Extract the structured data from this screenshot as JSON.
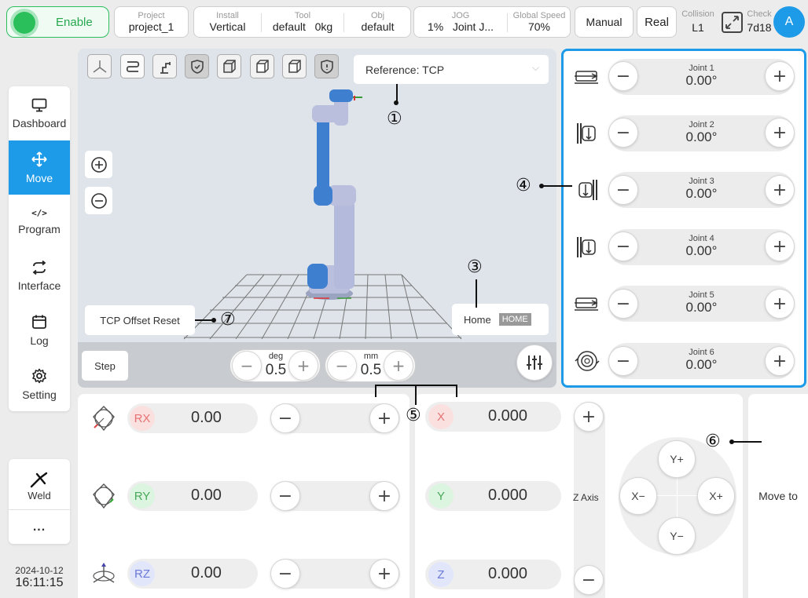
{
  "header": {
    "enable_label": "Enable",
    "project": {
      "label": "Project",
      "value": "project_1"
    },
    "install": {
      "label": "Install",
      "value": "Vertical"
    },
    "tool": {
      "label": "Tool",
      "value": "default",
      "load": "0kg"
    },
    "obj": {
      "label": "Obj",
      "value": "default"
    },
    "jog": {
      "label": "JOG",
      "percent": "1%",
      "mode": "Joint J..."
    },
    "global_speed": {
      "label": "Global Speed",
      "value": "70%"
    },
    "mode_button": "Manual",
    "real_button": "Real",
    "collision": {
      "label": "Collision",
      "value": "L1"
    },
    "check": {
      "label": "Check",
      "value": "7d18"
    },
    "avatar": "A"
  },
  "sidebar": {
    "items": [
      {
        "label": "Dashboard",
        "icon": "monitor-icon"
      },
      {
        "label": "Move",
        "icon": "move-arrows-icon",
        "active": true
      },
      {
        "label": "Program",
        "icon": "code-icon"
      },
      {
        "label": "Interface",
        "icon": "swap-icon"
      },
      {
        "label": "Log",
        "icon": "calendar-icon"
      },
      {
        "label": "Setting",
        "icon": "gear-icon"
      }
    ],
    "weld_label": "Weld",
    "more_label": "...",
    "date": "2024-10-12",
    "time": "16:11:15"
  },
  "viewport": {
    "reference": "Reference: TCP",
    "tcp_offset_reset": "TCP Offset Reset",
    "home_label": "Home",
    "home_badge": "HOME",
    "step_label": "Step",
    "deg_unit": "deg",
    "deg_value": "0.5",
    "mm_unit": "mm",
    "mm_value": "0.5"
  },
  "joints": [
    {
      "label": "Joint 1",
      "value": "0.00°"
    },
    {
      "label": "Joint 2",
      "value": "0.00°"
    },
    {
      "label": "Joint 3",
      "value": "0.00°"
    },
    {
      "label": "Joint 4",
      "value": "0.00°"
    },
    {
      "label": "Joint 5",
      "value": "0.00°"
    },
    {
      "label": "Joint 6",
      "value": "0.00°"
    }
  ],
  "rotation": [
    {
      "axis": "RX",
      "value": "0.00",
      "color": "#e57373"
    },
    {
      "axis": "RY",
      "value": "0.00",
      "color": "#5cbf6a"
    },
    {
      "axis": "RZ",
      "value": "0.00",
      "color": "#6a79d8"
    }
  ],
  "translation": [
    {
      "axis": "X",
      "value": "0.000",
      "color": "#e57373"
    },
    {
      "axis": "Y",
      "value": "0.000",
      "color": "#5cbf6a"
    },
    {
      "axis": "Z",
      "value": "0.000",
      "color": "#6a79d8"
    }
  ],
  "pad": {
    "z_axis_label": "Z Axis",
    "y_plus": "Y+",
    "y_minus": "Y−",
    "x_plus": "X+",
    "x_minus": "X−"
  },
  "move_to_label": "Move to",
  "annotations": [
    "①",
    "③",
    "④",
    "⑤",
    "⑥",
    "⑦"
  ],
  "colors": {
    "accent": "#1e9be8",
    "enable_green": "#27c35f"
  }
}
